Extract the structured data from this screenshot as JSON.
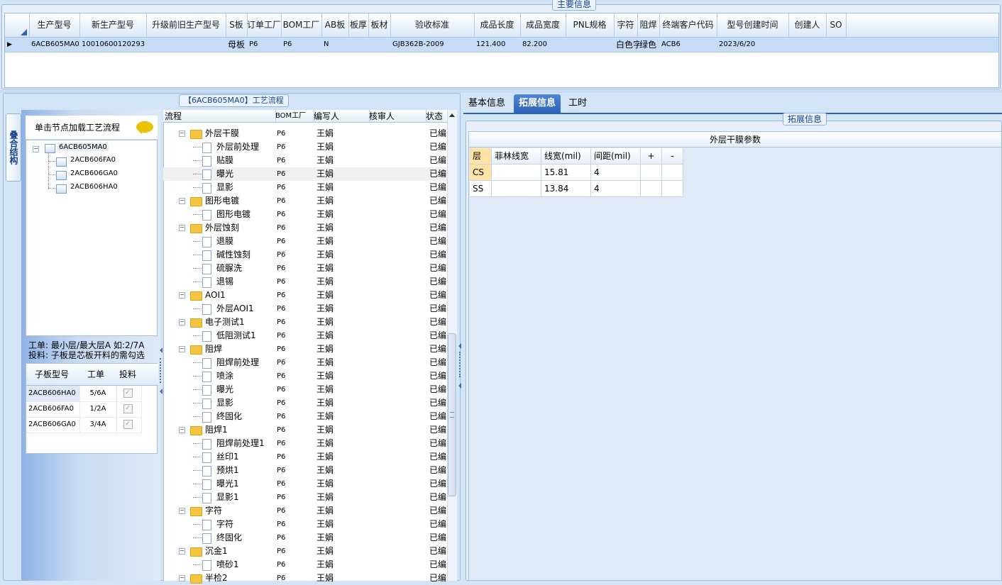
{
  "main_info": {
    "title": "主要信息",
    "columns": [
      "生产型号",
      "新生产型号",
      "升级前旧生产型号",
      "S板",
      "订单工厂",
      "BOM工厂",
      "AB板",
      "板厚",
      "板材",
      "验收标准",
      "成品长度",
      "成品宽度",
      "PNL规格",
      "字符",
      "阻焊",
      "终端客户代码",
      "型号创建时间",
      "创建人",
      "SO"
    ],
    "row": [
      "6ACB605MA0",
      "10010600120293",
      "",
      "母板",
      "P6",
      "P6",
      "N",
      "",
      "",
      "GJB362B-2009",
      "121.400",
      "82.200",
      "",
      "白色字符",
      "绿色",
      "ACB6",
      "2023/6/20",
      "",
      ""
    ]
  },
  "left": {
    "vertical_tab": "叠合结构",
    "tree_header": "单击节点加载工艺流程",
    "tree": {
      "root": "6ACB605MA0",
      "children": [
        "2ACB606FA0",
        "2ACB606GA0",
        "2ACB606HA0"
      ]
    },
    "hint_line1": "工单: 最小层/最大层A 如:2/7A",
    "hint_line2": "投料: 子板是芯板开料的需勾选",
    "subgrid": {
      "columns": [
        "子板型号",
        "工单",
        "投料"
      ],
      "rows": [
        [
          "2ACB606HA0",
          "5/6A",
          "✓"
        ],
        [
          "2ACB606FA0",
          "1/2A",
          "✓"
        ],
        [
          "2ACB606GA0",
          "3/4A",
          "✓"
        ]
      ]
    }
  },
  "process": {
    "title": "【6ACB605MA0】工艺流程",
    "columns": [
      "流程",
      "BOM工厂",
      "编写人",
      "核审人",
      "状态"
    ],
    "rows": [
      {
        "name": "外层干膜",
        "level": 0,
        "bom": "P6",
        "writer": "王娟",
        "status": "已编写"
      },
      {
        "name": "外层前处理",
        "level": 1,
        "bom": "P6",
        "writer": "王娟",
        "status": "已编写"
      },
      {
        "name": "贴膜",
        "level": 1,
        "bom": "P6",
        "writer": "王娟",
        "status": "已编写"
      },
      {
        "name": "曝光",
        "level": 1,
        "bom": "P6",
        "writer": "王娟",
        "status": "已编写"
      },
      {
        "name": "显影",
        "level": 1,
        "bom": "P6",
        "writer": "王娟",
        "status": "已编写"
      },
      {
        "name": "图形电镀",
        "level": 0,
        "bom": "P6",
        "writer": "王娟",
        "status": "已编写"
      },
      {
        "name": "图形电镀",
        "level": 1,
        "bom": "P6",
        "writer": "王娟",
        "status": "已编写"
      },
      {
        "name": "外层蚀刻",
        "level": 0,
        "bom": "P6",
        "writer": "王娟",
        "status": "已编写"
      },
      {
        "name": "退膜",
        "level": 1,
        "bom": "P6",
        "writer": "王娟",
        "status": "已编写"
      },
      {
        "name": "碱性蚀刻",
        "level": 1,
        "bom": "P6",
        "writer": "王娟",
        "status": "已编写"
      },
      {
        "name": "硫脲洗",
        "level": 1,
        "bom": "P6",
        "writer": "王娟",
        "status": "已编写"
      },
      {
        "name": "退锡",
        "level": 1,
        "bom": "P6",
        "writer": "王娟",
        "status": "已编写"
      },
      {
        "name": "AOI1",
        "level": 0,
        "bom": "P6",
        "writer": "王娟",
        "status": "已编写"
      },
      {
        "name": "外层AOI1",
        "level": 1,
        "bom": "P6",
        "writer": "王娟",
        "status": "已编写"
      },
      {
        "name": "电子测试1",
        "level": 0,
        "bom": "P6",
        "writer": "王娟",
        "status": "已编写"
      },
      {
        "name": "低阻测试1",
        "level": 1,
        "bom": "P6",
        "writer": "王娟",
        "status": "已编写"
      },
      {
        "name": "阻焊",
        "level": 0,
        "bom": "P6",
        "writer": "王娟",
        "status": "已编写"
      },
      {
        "name": "阻焊前处理",
        "level": 1,
        "bom": "P6",
        "writer": "王娟",
        "status": "已编写"
      },
      {
        "name": "喷涂",
        "level": 1,
        "bom": "P6",
        "writer": "王娟",
        "status": "已编写"
      },
      {
        "name": "曝光",
        "level": 1,
        "bom": "P6",
        "writer": "王娟",
        "status": "已编写"
      },
      {
        "name": "显影",
        "level": 1,
        "bom": "P6",
        "writer": "王娟",
        "status": "已编写"
      },
      {
        "name": "终固化",
        "level": 1,
        "bom": "P6",
        "writer": "王娟",
        "status": "已编写"
      },
      {
        "name": "阻焊1",
        "level": 0,
        "bom": "P6",
        "writer": "王娟",
        "status": "已编写"
      },
      {
        "name": "阻焊前处理1",
        "level": 1,
        "bom": "P6",
        "writer": "王娟",
        "status": "已编写"
      },
      {
        "name": "丝印1",
        "level": 1,
        "bom": "P6",
        "writer": "王娟",
        "status": "已编写"
      },
      {
        "name": "预烘1",
        "level": 1,
        "bom": "P6",
        "writer": "王娟",
        "status": "已编写"
      },
      {
        "name": "曝光1",
        "level": 1,
        "bom": "P6",
        "writer": "王娟",
        "status": "已编写"
      },
      {
        "name": "显影1",
        "level": 1,
        "bom": "P6",
        "writer": "王娟",
        "status": "已编写"
      },
      {
        "name": "字符",
        "level": 0,
        "bom": "P6",
        "writer": "王娟",
        "status": "已编写"
      },
      {
        "name": "字符",
        "level": 1,
        "bom": "P6",
        "writer": "王娟",
        "status": "已编写"
      },
      {
        "name": "终固化",
        "level": 1,
        "bom": "P6",
        "writer": "王娟",
        "status": "已编写"
      },
      {
        "name": "沉金1",
        "level": 0,
        "bom": "P6",
        "writer": "王娟",
        "status": "已编写"
      },
      {
        "name": "喷砂1",
        "level": 1,
        "bom": "P6",
        "writer": "王娟",
        "status": "已编写"
      },
      {
        "name": "半检2",
        "level": 0,
        "bom": "P6",
        "writer": "王娟",
        "status": "已编写"
      }
    ]
  },
  "right": {
    "tabs": [
      "基本信息",
      "拓展信息",
      "工时"
    ],
    "active_tab": "拓展信息",
    "group_title": "拓展信息",
    "table_title": "外层干膜参数",
    "param_columns": [
      "层",
      "菲林线宽",
      "线宽(mil)",
      "间距(mil)",
      "+",
      "-"
    ],
    "param_rows": [
      [
        "CS",
        "",
        "15.81",
        "4",
        "",
        ""
      ],
      [
        "SS",
        "",
        "13.84",
        "4",
        "",
        ""
      ]
    ]
  },
  "colors": {
    "selection_row": "#c6dcf7",
    "active_tab": "#2d63b8",
    "folder": "#f5c542",
    "layer_cell": "#ffe2a6"
  }
}
